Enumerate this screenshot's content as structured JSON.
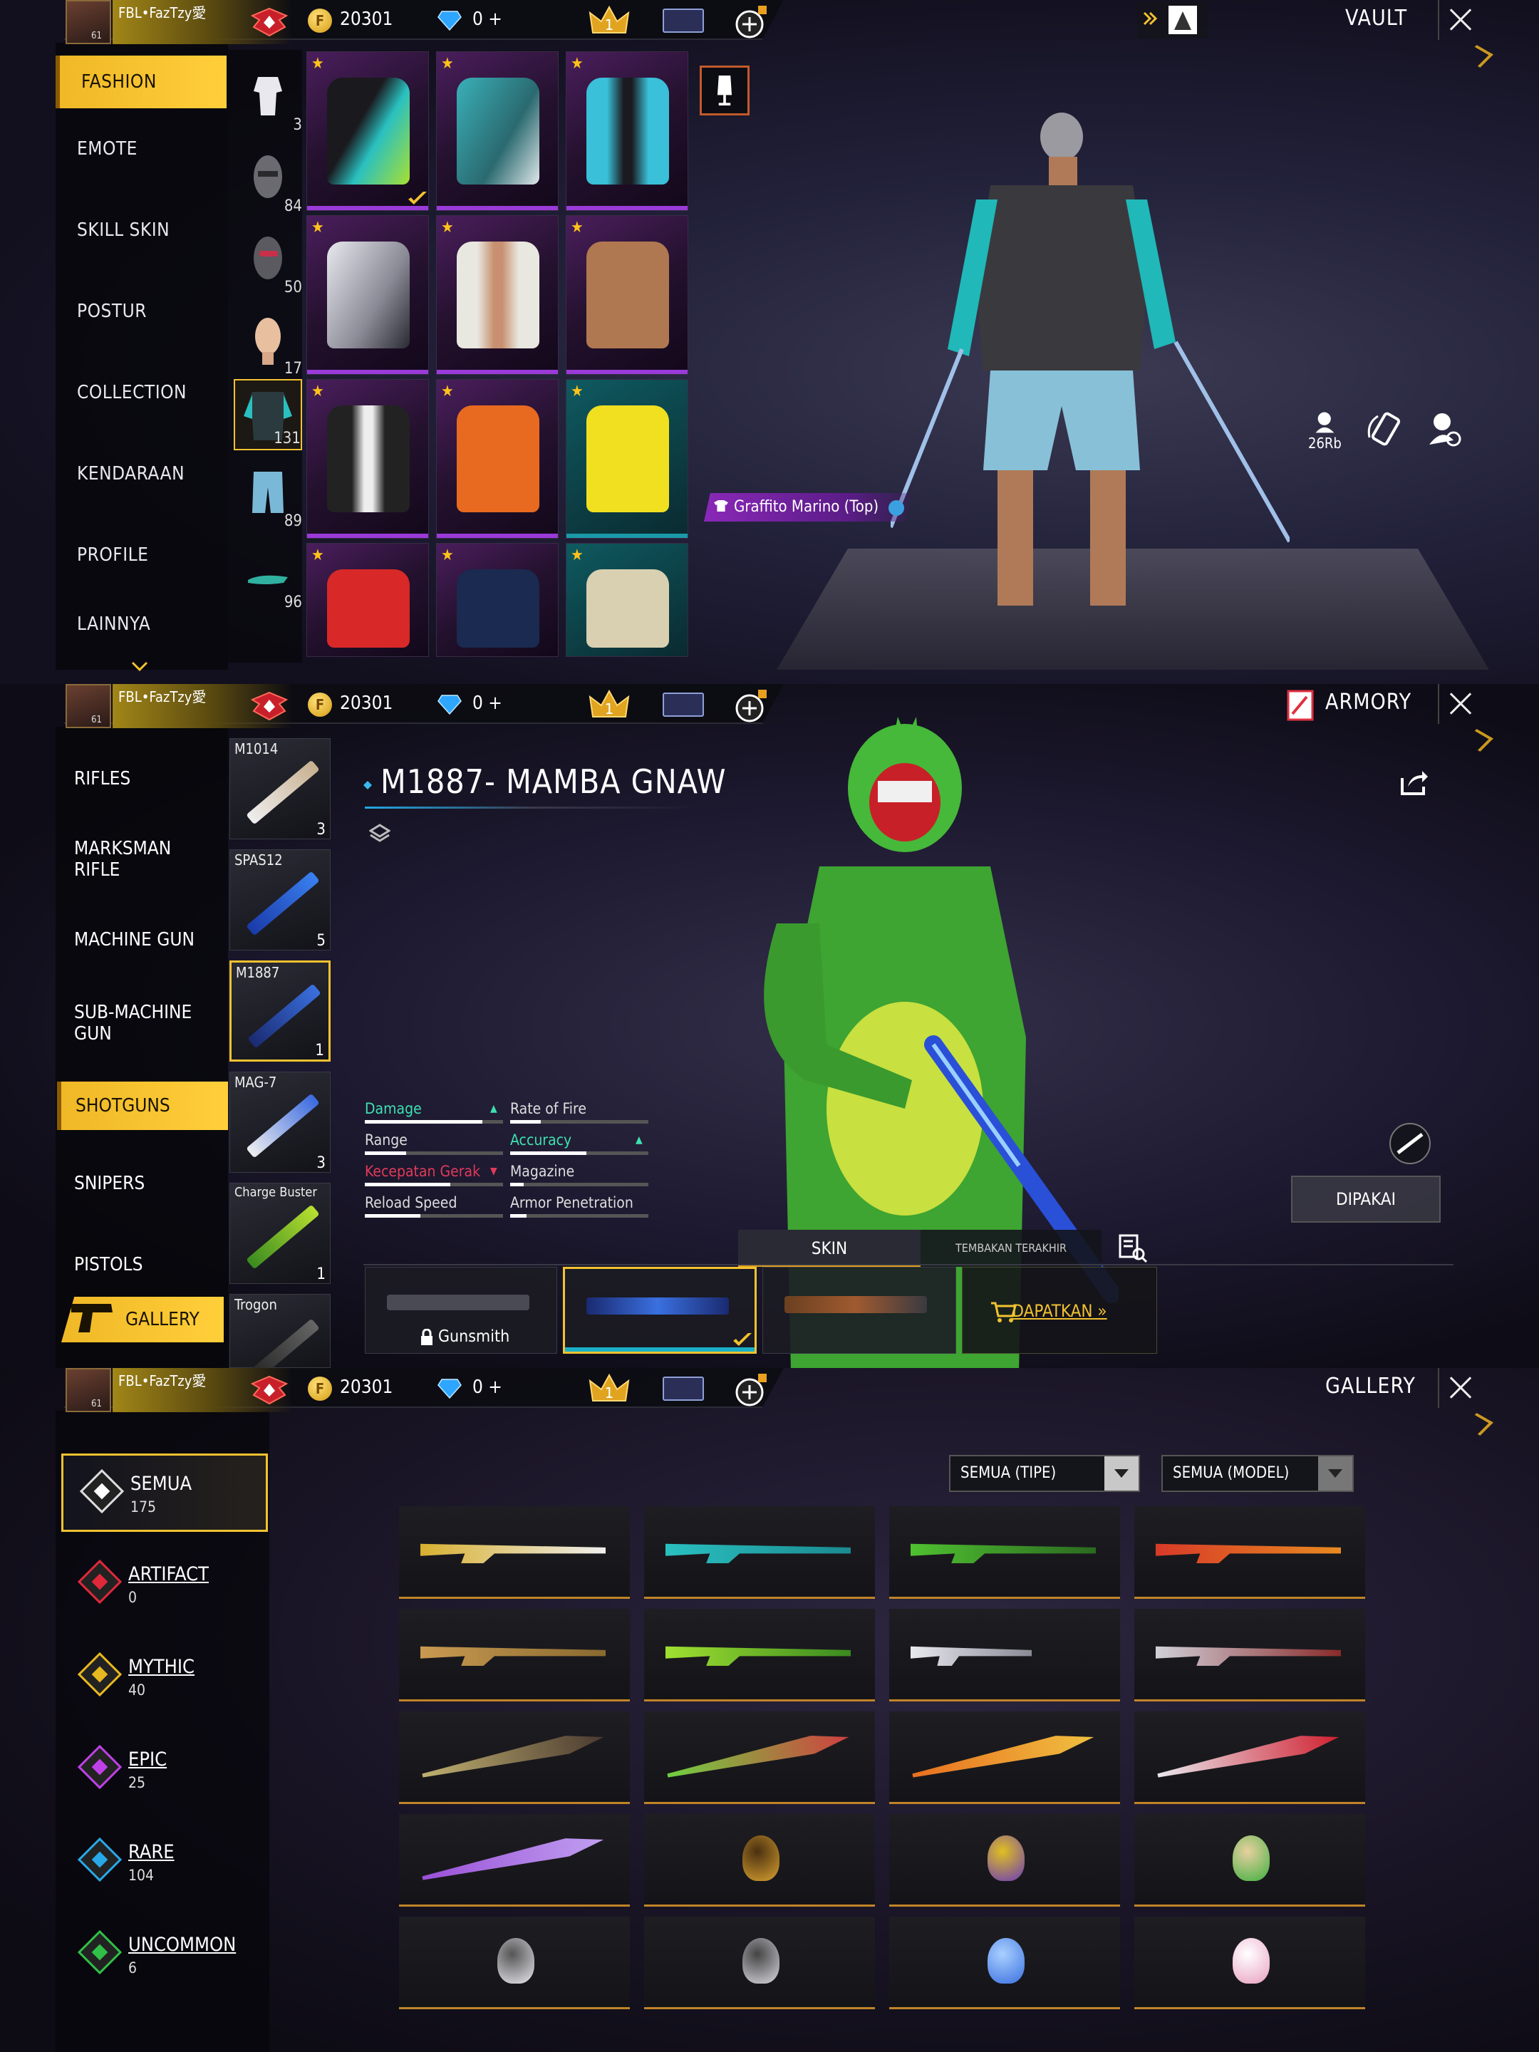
{
  "top": {
    "player": "FBL•FazTzy愛",
    "level": "61",
    "gold": "20301",
    "diamonds": "0 +",
    "crown_rank": "1"
  },
  "vault": {
    "title": "VAULT",
    "menu": [
      "FASHION",
      "EMOTE",
      "SKILL SKIN",
      "POSTUR",
      "COLLECTION",
      "KENDARAAN",
      "PROFILE",
      "LAINNYA"
    ],
    "active_menu": "FASHION",
    "categories": [
      {
        "icon": "outfit-icon",
        "count": "3"
      },
      {
        "icon": "mask-icon",
        "count": "84"
      },
      {
        "icon": "glasses-mask-icon",
        "count": "50"
      },
      {
        "icon": "head-icon",
        "count": "17"
      },
      {
        "icon": "jacket-icon",
        "count": "131"
      },
      {
        "icon": "shorts-icon",
        "count": "89"
      },
      {
        "icon": "shoes-icon",
        "count": "96"
      }
    ],
    "selected_item_label": "Graffito Marino (Top)",
    "side_count": "26Rb"
  },
  "armory": {
    "title": "ARMORY",
    "menu": [
      "RIFLES",
      "MARKSMAN RIFLE",
      "MACHINE GUN",
      "SUB-MACHINE GUN",
      "SHOTGUNS",
      "SNIPERS",
      "PISTOLS"
    ],
    "active_menu": "SHOTGUNS",
    "gallery_label": "GALLERY",
    "weapons": [
      {
        "name": "M1014",
        "count": "3"
      },
      {
        "name": "SPAS12",
        "count": "5"
      },
      {
        "name": "M1887",
        "count": "1"
      },
      {
        "name": "MAG-7",
        "count": "3"
      },
      {
        "name": "Charge Buster",
        "count": "1"
      },
      {
        "name": "Trogon",
        "count": ""
      }
    ],
    "weapon_title": "M1887- MAMBA GNAW",
    "stats_left": [
      {
        "label": "Damage",
        "value": 0.85,
        "color": "#3ee0b0",
        "trend": "up"
      },
      {
        "label": "Range",
        "value": 0.3,
        "color": "#dddddd",
        "trend": ""
      },
      {
        "label": "Kecepatan Gerak",
        "value": 0.62,
        "color": "#e03a5a",
        "trend": "down"
      },
      {
        "label": "Reload Speed",
        "value": 0.4,
        "color": "#dddddd",
        "trend": ""
      }
    ],
    "stats_right": [
      {
        "label": "Rate of Fire",
        "value": 0.22,
        "color": "#dddddd",
        "trend": ""
      },
      {
        "label": "Accuracy",
        "value": 0.55,
        "color": "#3ee0b0",
        "trend": "up"
      },
      {
        "label": "Magazine",
        "value": 0.1,
        "color": "#dddddd",
        "trend": ""
      },
      {
        "label": "Armor Penetration",
        "value": 0.12,
        "color": "#dddddd",
        "trend": ""
      }
    ],
    "tab_skin": "SKIN",
    "tab_recent": "TEMBAKAN TERAKHIR",
    "locked_label": "Gunsmith",
    "get_label": "DAPATKAN",
    "equipped_label": "DIPAKAI"
  },
  "gallery": {
    "title": "GALLERY",
    "rarities": [
      {
        "name": "SEMUA",
        "count": "175",
        "color": "#ffffff"
      },
      {
        "name": "ARTIFACT",
        "count": "0",
        "color": "#e0283a"
      },
      {
        "name": "MYTHIC",
        "count": "40",
        "color": "#e8b820"
      },
      {
        "name": "EPIC",
        "count": "25",
        "color": "#c040e8"
      },
      {
        "name": "RARE",
        "count": "104",
        "color": "#28a8e8"
      },
      {
        "name": "UNCOMMON",
        "count": "6",
        "color": "#30c048"
      }
    ],
    "filter_type": "SEMUA (TIPE)",
    "filter_model": "SEMUA (MODEL)"
  }
}
